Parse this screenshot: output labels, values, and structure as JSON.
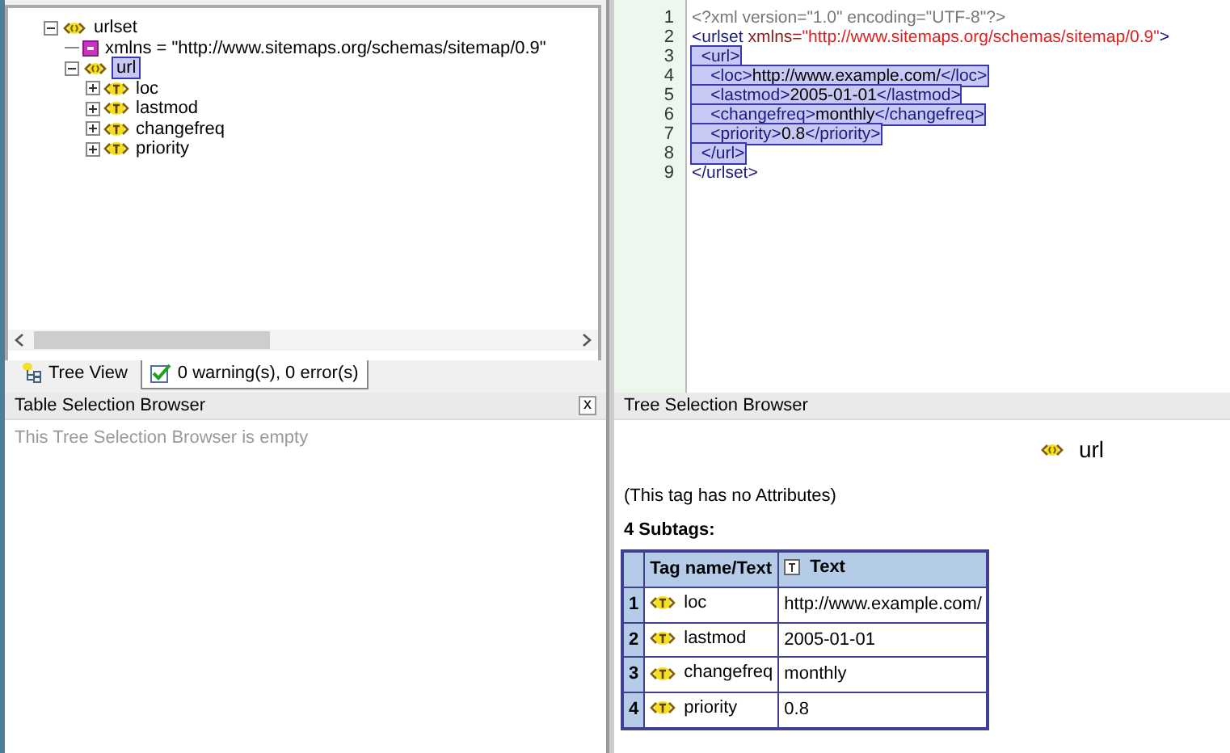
{
  "tree": [
    {
      "kind": "element",
      "label": "urlset",
      "expanded": true,
      "selected": false,
      "children": [
        {
          "kind": "attribute",
          "label": "xmlns = \"http://www.sitemaps.org/schemas/sitemap/0.9\"",
          "selected": false
        },
        {
          "kind": "element",
          "label": "url",
          "expanded": true,
          "selected": true,
          "children": [
            {
              "kind": "text-element",
              "label": "loc",
              "expanded": false,
              "selected": false
            },
            {
              "kind": "text-element",
              "label": "lastmod",
              "expanded": false,
              "selected": false
            },
            {
              "kind": "text-element",
              "label": "changefreq",
              "expanded": false,
              "selected": false
            },
            {
              "kind": "text-element",
              "label": "priority",
              "expanded": false,
              "selected": false
            }
          ]
        }
      ]
    }
  ],
  "view_tabs": [
    {
      "label": "Tree View",
      "kind": "tree",
      "selected": true
    },
    {
      "label": "0 warning(s), 0 error(s)",
      "kind": "check",
      "selected": false
    }
  ],
  "editor": {
    "lines": [
      {
        "number": "1",
        "selected": false,
        "tokens": [
          {
            "kind": "pi",
            "text": "<?xml version=\"1.0\" encoding=\"UTF-8\"?>"
          }
        ]
      },
      {
        "number": "2",
        "selected": false,
        "tokens": [
          {
            "kind": "tag",
            "text": "<urlset "
          },
          {
            "kind": "attr",
            "text": "xmlns="
          },
          {
            "kind": "value",
            "text": "\"http://www.sitemaps.org/schemas/sitemap/0.9\""
          },
          {
            "kind": "tag",
            "text": ">"
          }
        ]
      },
      {
        "number": "3",
        "selected": true,
        "tokens": [
          {
            "kind": "tag",
            "text": "  <url>"
          }
        ]
      },
      {
        "number": "4",
        "selected": true,
        "tokens": [
          {
            "kind": "tag",
            "text": "    <loc>"
          },
          {
            "kind": "text",
            "text": "http://www.example.com/"
          },
          {
            "kind": "tag",
            "text": "</loc>"
          }
        ]
      },
      {
        "number": "5",
        "selected": true,
        "tokens": [
          {
            "kind": "tag",
            "text": "    <lastmod>"
          },
          {
            "kind": "text",
            "text": "2005-01-01"
          },
          {
            "kind": "tag",
            "text": "</lastmod>"
          }
        ]
      },
      {
        "number": "6",
        "selected": true,
        "tokens": [
          {
            "kind": "tag",
            "text": "    <changefreq>"
          },
          {
            "kind": "text",
            "text": "monthly"
          },
          {
            "kind": "tag",
            "text": "</changefreq>"
          }
        ]
      },
      {
        "number": "7",
        "selected": true,
        "tokens": [
          {
            "kind": "tag",
            "text": "    <priority>"
          },
          {
            "kind": "text",
            "text": "0.8"
          },
          {
            "kind": "tag",
            "text": "</priority>"
          }
        ]
      },
      {
        "number": "8",
        "selected": true,
        "tokens": [
          {
            "kind": "tag",
            "text": "  </url>"
          }
        ]
      },
      {
        "number": "9",
        "selected": false,
        "tokens": [
          {
            "kind": "tag",
            "text": "</urlset>"
          }
        ]
      }
    ]
  },
  "table_browser": {
    "title": "Table Selection Browser",
    "close": "x",
    "message": "This Tree Selection Browser is empty"
  },
  "tree_browser": {
    "title": "Tree Selection Browser",
    "tag": "url",
    "attributes_note": "(This tag has no Attributes)",
    "subtags_heading": "4 Subtags:",
    "columns": [
      "Tag name/Text",
      "Text"
    ],
    "rows": [
      {
        "index": "1",
        "tag": "loc",
        "text": "http://www.example.com/"
      },
      {
        "index": "2",
        "tag": "lastmod",
        "text": "2005-01-01"
      },
      {
        "index": "3",
        "tag": "changefreq",
        "text": "monthly"
      },
      {
        "index": "4",
        "tag": "priority",
        "text": "0.8"
      }
    ]
  }
}
